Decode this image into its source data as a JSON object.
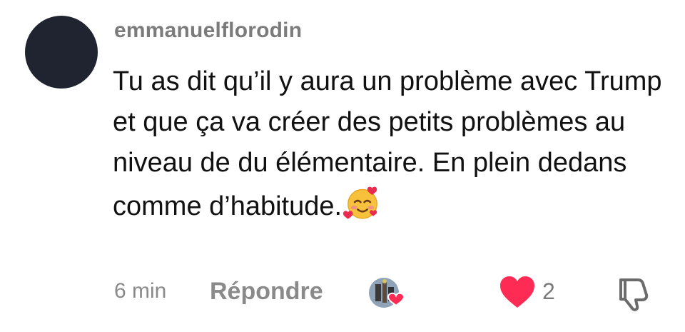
{
  "comment": {
    "username": "emmanuelflorodin",
    "text": "Tu as dit qu’il y aura un problème avec Trump et que ça va créer des petits problèmes au niveau de du élémentaire. En plein dedans comme d’habitude.",
    "emoji": "smiling-face-with-hearts-icon"
  },
  "footer": {
    "time": "6 min",
    "reply_label": "Répondre",
    "creator_liked_icon": "creator-avatar-heart-icon",
    "like_icon": "heart-icon",
    "like_count": "2",
    "dislike_icon": "thumbs-down-icon"
  },
  "colors": {
    "avatar": "#1f2430",
    "username": "#7b7b7b",
    "text": "#111111",
    "meta": "#8a8a8a",
    "heart": "#fe2c55"
  }
}
